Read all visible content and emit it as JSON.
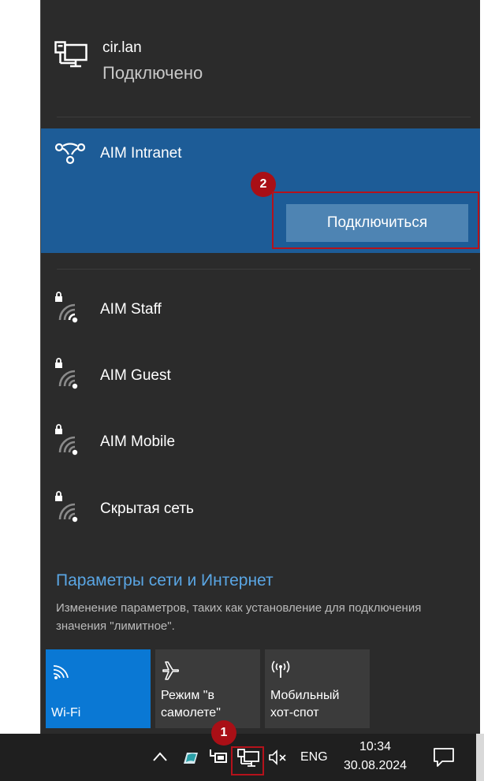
{
  "wired": {
    "name": "cir.lan",
    "status": "Подключено",
    "icon": "wired-network-icon"
  },
  "selected_network": {
    "name": "AIM Intranet",
    "icon": "network-link-icon",
    "connect_label": "Подключиться",
    "step_badge": "2"
  },
  "networks": [
    {
      "name": "AIM Staff",
      "icon": "secured-wifi-icon"
    },
    {
      "name": "AIM Guest",
      "icon": "secured-wifi-icon"
    },
    {
      "name": "AIM Mobile",
      "icon": "secured-wifi-icon"
    },
    {
      "name": "Скрытая сеть",
      "icon": "secured-wifi-icon"
    }
  ],
  "settings": {
    "link": "Параметры сети и Интернет",
    "description": "Изменение параметров, таких как установление для подключения значения \"лимитное\"."
  },
  "quick_actions": [
    {
      "label": "Wi-Fi",
      "icon": "wifi-icon",
      "active": true
    },
    {
      "label": "Режим \"в самолете\"",
      "icon": "airplane-icon",
      "active": false
    },
    {
      "label": "Мобильный хот-спот",
      "icon": "hotspot-icon",
      "active": false
    }
  ],
  "taskbar": {
    "step_badge": "1",
    "language": "ENG",
    "time": "10:34",
    "date": "30.08.2024"
  },
  "colors": {
    "panel": "#2b2b2b",
    "selected": "#1d5c97",
    "accent": "#0a78d4",
    "link": "#5aa6e4",
    "highlight_box": "#b5121b"
  }
}
